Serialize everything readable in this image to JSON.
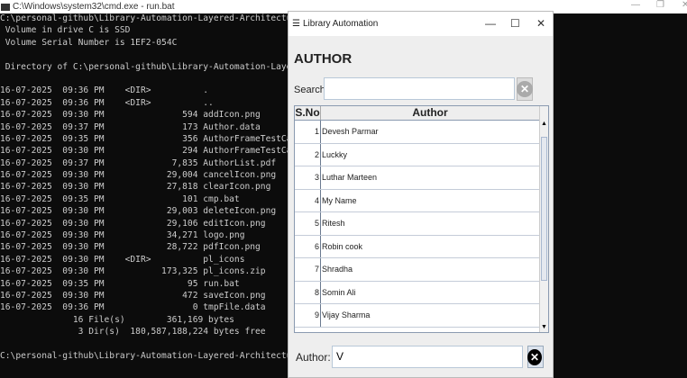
{
  "console": {
    "title": "C:\\Windows\\system32\\cmd.exe - run.bat",
    "lines": [
      "C:\\personal-github\\Library-Automation-Layered-Architecture\\library\\pl\\te",
      " Volume in drive C is SSD",
      " Volume Serial Number is 1EF2-054C",
      "",
      " Directory of C:\\personal-github\\Library-Automation-Layered-Architecture",
      "",
      "16-07-2025  09:36 PM    <DIR>          .",
      "16-07-2025  09:36 PM    <DIR>          ..",
      "16-07-2025  09:30 PM               594 addIcon.png",
      "16-07-2025  09:37 PM               173 Author.data",
      "16-07-2025  09:35 PM               356 AuthorFrameTestCase.class",
      "16-07-2025  09:30 PM               294 AuthorFrameTestCase.java",
      "16-07-2025  09:37 PM             7,835 AuthorList.pdf",
      "16-07-2025  09:30 PM            29,004 cancelIcon.png",
      "16-07-2025  09:30 PM            27,818 clearIcon.png",
      "16-07-2025  09:35 PM               101 cmp.bat",
      "16-07-2025  09:30 PM            29,003 deleteIcon.png",
      "16-07-2025  09:30 PM            29,106 editIcon.png",
      "16-07-2025  09:30 PM            34,271 logo.png",
      "16-07-2025  09:30 PM            28,722 pdfIcon.png",
      "16-07-2025  09:30 PM    <DIR>          pl_icons",
      "16-07-2025  09:30 PM           173,325 pl_icons.zip",
      "16-07-2025  09:35 PM                95 run.bat",
      "16-07-2025  09:30 PM               472 saveIcon.png",
      "16-07-2025  09:36 PM                 0 tmpFile.data",
      "              16 File(s)        361,169 bytes",
      "               3 Dir(s)  180,587,188,224 bytes free",
      "",
      "C:\\personal-github\\Library-Automation-Layered-Architecture\\library\\pl\\te"
    ]
  },
  "dialog": {
    "title": "Library Automation",
    "heading": "AUTHOR",
    "search_label": "Search",
    "search_value": "",
    "columns": [
      "S.No",
      "Author"
    ],
    "rows": [
      [
        "1",
        "Devesh Parmar"
      ],
      [
        "2",
        "Luckky"
      ],
      [
        "3",
        "Luthar Marteen"
      ],
      [
        "4",
        "My Name"
      ],
      [
        "5",
        "Ritesh"
      ],
      [
        "6",
        "Robin cook"
      ],
      [
        "7",
        "Shradha"
      ],
      [
        "8",
        "Somin Ali"
      ],
      [
        "9",
        "Vijay Sharma"
      ]
    ],
    "author_label": "Author:",
    "author_value": "V"
  },
  "colors": {
    "console_bg": "#0c0c0c",
    "dialog_bg": "#eeeeee"
  }
}
